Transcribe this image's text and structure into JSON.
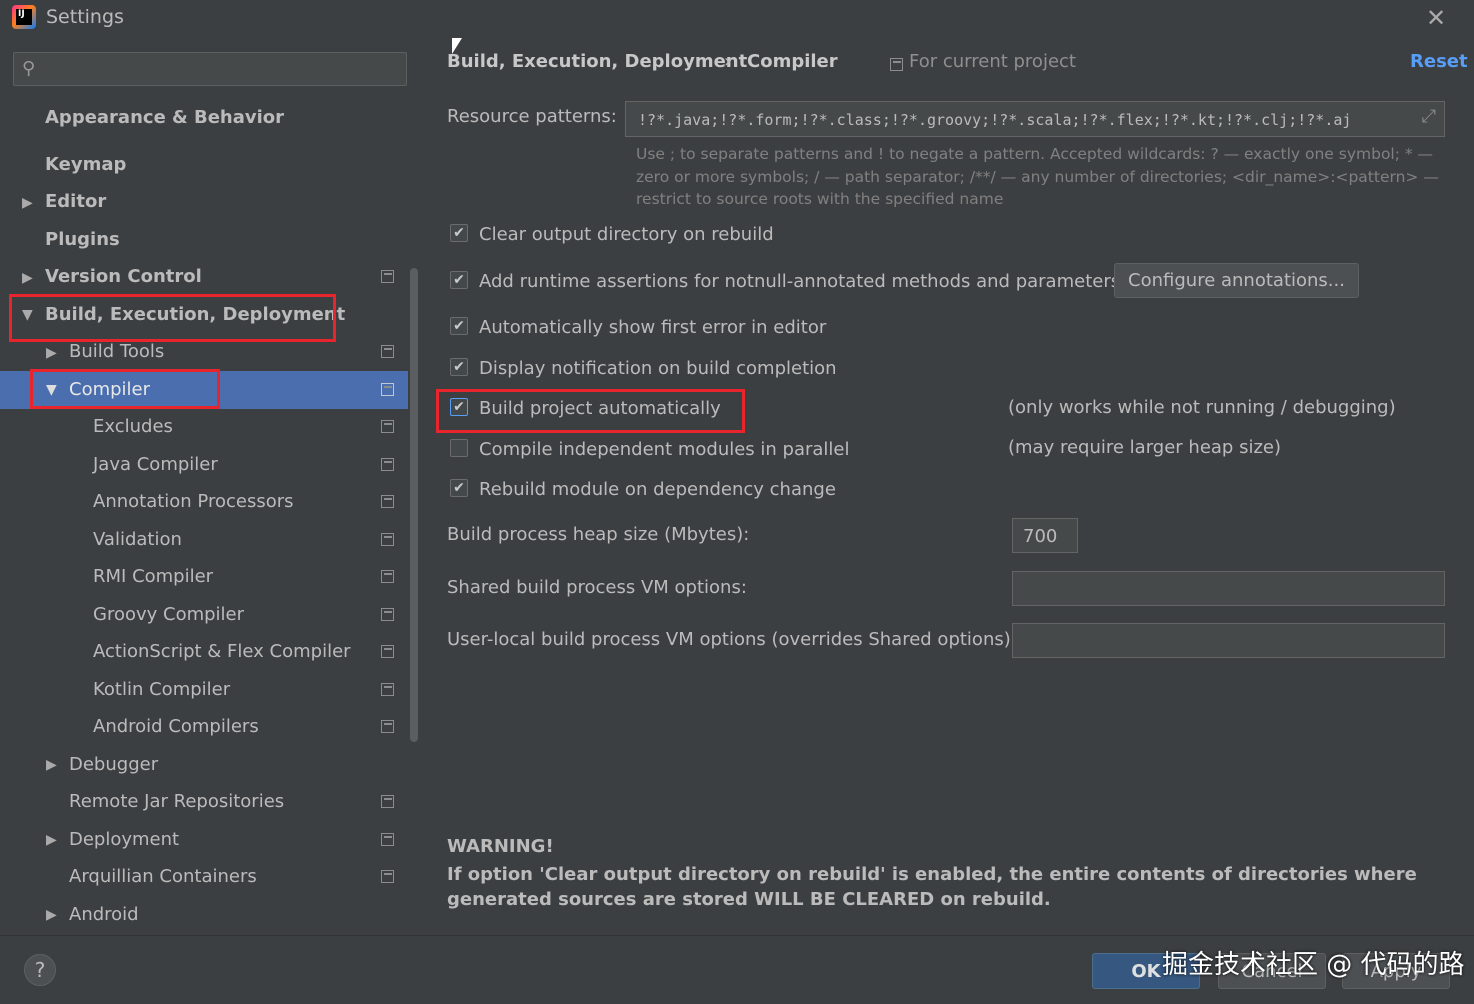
{
  "window": {
    "title": "Settings",
    "close_glyph": "✕",
    "logo_text": "IJ"
  },
  "search": {
    "placeholder": "",
    "icon": "search-icon"
  },
  "sidebar": {
    "items": [
      {
        "label": "Appearance & Behavior",
        "arrow": ""
      },
      {
        "label": "Keymap",
        "arrow": ""
      },
      {
        "label": "Editor",
        "arrow": "▶"
      },
      {
        "label": "Plugins",
        "arrow": ""
      },
      {
        "label": "Version Control",
        "arrow": "▶"
      },
      {
        "label": "Build, Execution, Deployment",
        "arrow": "▼"
      },
      {
        "label": "Build Tools",
        "arrow": "▶"
      },
      {
        "label": "Compiler",
        "arrow": "▼"
      },
      {
        "label": "Excludes",
        "arrow": ""
      },
      {
        "label": "Java Compiler",
        "arrow": ""
      },
      {
        "label": "Annotation Processors",
        "arrow": ""
      },
      {
        "label": "Validation",
        "arrow": ""
      },
      {
        "label": "RMI Compiler",
        "arrow": ""
      },
      {
        "label": "Groovy Compiler",
        "arrow": ""
      },
      {
        "label": "ActionScript & Flex Compiler",
        "arrow": ""
      },
      {
        "label": "Kotlin Compiler",
        "arrow": ""
      },
      {
        "label": "Android Compilers",
        "arrow": ""
      },
      {
        "label": "Debugger",
        "arrow": "▶"
      },
      {
        "label": "Remote Jar Repositories",
        "arrow": ""
      },
      {
        "label": "Deployment",
        "arrow": "▶"
      },
      {
        "label": "Arquillian Containers",
        "arrow": ""
      },
      {
        "label": "Android",
        "arrow": "▶"
      }
    ]
  },
  "header": {
    "breadcrumb_parent": "Build, Execution, Deployment",
    "breadcrumb_separator": "›",
    "breadcrumb_current": "Compiler",
    "scope": "For current project",
    "reset": "Reset"
  },
  "resource_patterns": {
    "label": "Resource patterns:",
    "value": "!?*.java;!?*.form;!?*.class;!?*.groovy;!?*.scala;!?*.flex;!?*.kt;!?*.clj;!?*.aj",
    "hint_line1": "Use ; to separate patterns and ! to negate a pattern. Accepted wildcards: ? — exactly one symbol; * —",
    "hint_line2": "zero or more symbols; / — path separator; /**/ — any number of directories; <dir_name>:<pattern> —",
    "hint_line3": "restrict to source roots with the specified name"
  },
  "options": {
    "clear_output": {
      "label": "Clear output directory on rebuild",
      "checked": true
    },
    "runtime_assertions": {
      "label": "Add runtime assertions for notnull-annotated methods and parameters",
      "checked": true
    },
    "show_first_error": {
      "label": "Automatically show first error in editor",
      "checked": true
    },
    "display_notification": {
      "label": "Display notification on build completion",
      "checked": true
    },
    "build_automatically": {
      "label": "Build project automatically",
      "checked": true,
      "note": "(only works while not running / debugging)"
    },
    "compile_parallel": {
      "label": "Compile independent modules in parallel",
      "checked": false,
      "note": "(may require larger heap size)"
    },
    "rebuild_on_dependency": {
      "label": "Rebuild module on dependency change",
      "checked": true
    }
  },
  "configure_annotations": "Configure annotations...",
  "heap": {
    "label": "Build process heap size (Mbytes):",
    "value": "700"
  },
  "shared_vm": {
    "label": "Shared build process VM options:",
    "value": ""
  },
  "user_vm": {
    "label": "User-local build process VM options (overrides Shared options):",
    "value": ""
  },
  "warning": {
    "title": "WARNING!",
    "text": "If option 'Clear output directory on rebuild' is enabled, the entire contents of directories where generated sources are stored WILL BE CLEARED on rebuild."
  },
  "footer": {
    "help": "?",
    "ok": "OK",
    "cancel": "Cancel",
    "apply": "Apply",
    "watermark": "掘金技术社区 @ 代码的路"
  },
  "colors": {
    "selection": "#4b6eaf",
    "highlight": "#e8252c",
    "link": "#589df6"
  }
}
